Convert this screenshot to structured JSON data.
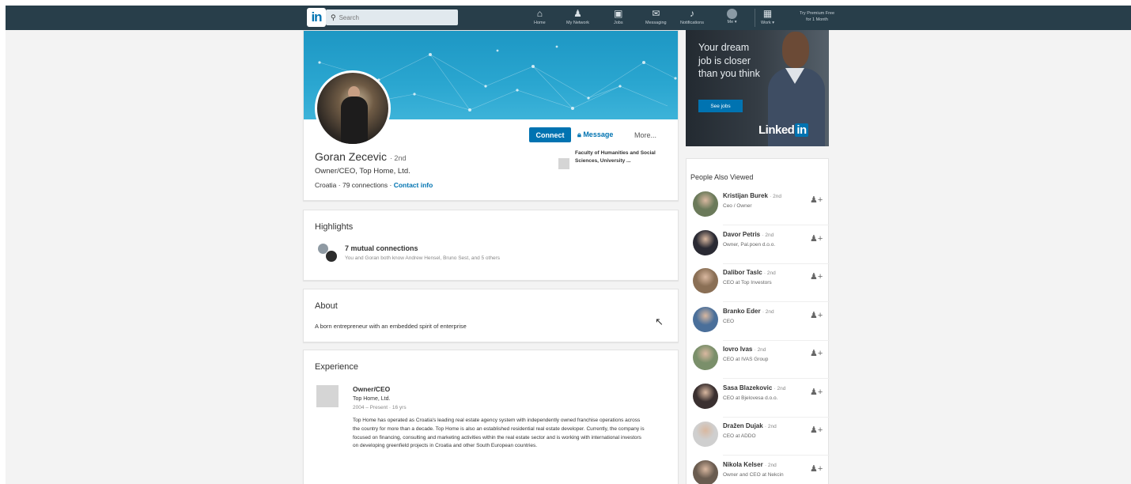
{
  "nav": {
    "logo": "in",
    "search_placeholder": "Search",
    "items": [
      {
        "label": "Home",
        "icon": "home-icon"
      },
      {
        "label": "My Network",
        "icon": "network-icon"
      },
      {
        "label": "Jobs",
        "icon": "jobs-icon"
      },
      {
        "label": "Messaging",
        "icon": "messaging-icon"
      },
      {
        "label": "Notifications",
        "icon": "bell-icon"
      },
      {
        "label": "Me ▾",
        "icon": "avatar"
      },
      {
        "label": "Work ▾",
        "icon": "grid-icon"
      }
    ],
    "premium_line1": "Try Premium Free",
    "premium_line2": "for 1 Month"
  },
  "profile": {
    "name": "Goran Zecevic",
    "degree": "· 2nd",
    "headline": "Owner/CEO, Top Home, Ltd.",
    "location": "Croatia",
    "connections": "79 connections",
    "contact": "Contact info",
    "school": "Faculty of Humanities and Social Sciences, University ...",
    "connect": "Connect",
    "message": "Message",
    "more": "More..."
  },
  "highlights": {
    "title": "Highlights",
    "mutual": "7 mutual connections",
    "mutual_sub": "You and Goran both know Andrew Hensel, Bruno Sest, and 5 others"
  },
  "about": {
    "title": "About",
    "text": "A born entrepreneur with an embedded spirit of enterprise"
  },
  "experience": {
    "title": "Experience",
    "role": "Owner/CEO",
    "company": "Top Home, Ltd.",
    "dates": "2004 – Present · 16 yrs",
    "description": "Top Home has operated as Croatia's leading real estate agency system with independently owned franchise operations across the country for more than a decade. Top Home is also an established residential real estate developer. Currently, the company is focused on financing, consulting and marketing activities within the real estate sector and is working with international investors on developing greenfield projects in Croatia and other South European countries."
  },
  "ad": {
    "headline": "Your dream job is closer than you think",
    "button": "See jobs",
    "brand": "Linked",
    "brand_in": "in"
  },
  "people_also_viewed": {
    "title": "People Also Viewed",
    "degree": "· 2nd",
    "items": [
      {
        "name": "Kristijan Burek",
        "sub": "Ceo / Owner",
        "color": "#6b7a5a"
      },
      {
        "name": "Davor Petris",
        "sub": "Owner, Pal.poen d.o.o.",
        "color": "#2a2a33"
      },
      {
        "name": "Dalibor Taslc",
        "sub": "CEO at Top Investors",
        "color": "#8a6f55"
      },
      {
        "name": "Branko Eder",
        "sub": "CEO",
        "color": "#4a6f9a"
      },
      {
        "name": "Iovro Ivas",
        "sub": "CEO at IVAS Group",
        "color": "#7a8f6a"
      },
      {
        "name": "Sasa Blazekovic",
        "sub": "CEO at Bjelovesa d.o.o.",
        "color": "#3a3030"
      },
      {
        "name": "Dražen Dujak",
        "sub": "CEO at ADDO",
        "color": "#cfcfcf"
      },
      {
        "name": "Nikola Kelser",
        "sub": "Owner and CEO at Nekcin",
        "color": "#6a5c50"
      }
    ]
  }
}
